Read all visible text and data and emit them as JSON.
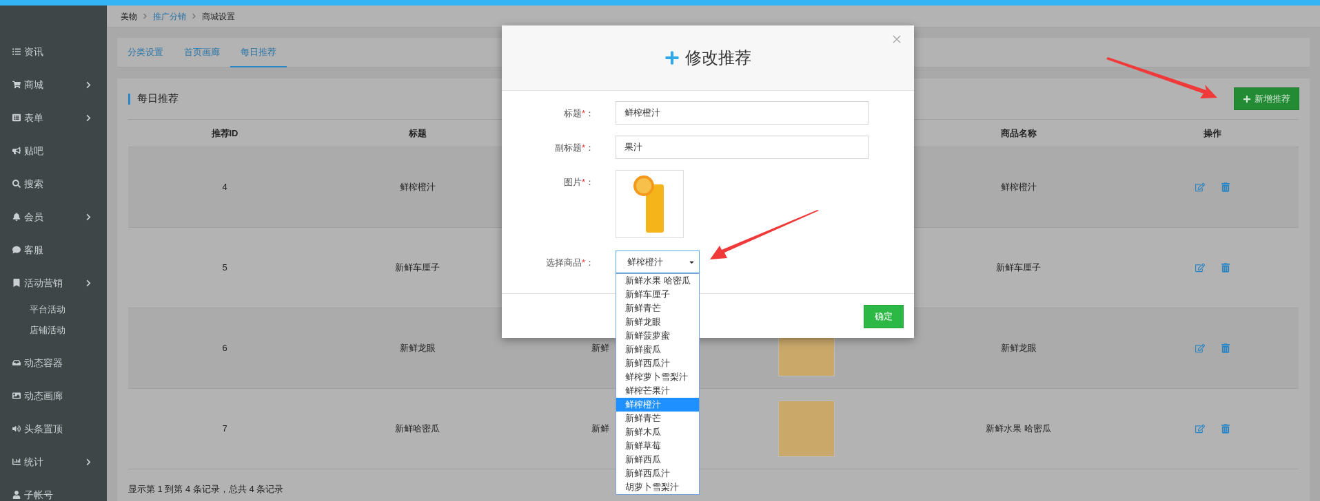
{
  "sidebar": {
    "items": [
      {
        "label": "资讯",
        "submenu": false
      },
      {
        "label": "商城",
        "submenu": true
      },
      {
        "label": "表单",
        "submenu": true
      },
      {
        "label": "贴吧",
        "submenu": false
      },
      {
        "label": "搜索",
        "submenu": false
      },
      {
        "label": "会员",
        "submenu": true
      },
      {
        "label": "客服",
        "submenu": false
      },
      {
        "label": "活动营销",
        "submenu": true,
        "children": [
          {
            "label": "平台活动"
          },
          {
            "label": "店铺活动"
          }
        ]
      },
      {
        "label": "动态容器",
        "submenu": false
      },
      {
        "label": "动态画廊",
        "submenu": false
      },
      {
        "label": "头条置顶",
        "submenu": false
      },
      {
        "label": "统计",
        "submenu": true
      },
      {
        "label": "子帐号",
        "submenu": false
      }
    ]
  },
  "breadcrumb": [
    {
      "label": "美物",
      "link": false
    },
    {
      "label": "推广分销",
      "link": true
    },
    {
      "label": "商城设置",
      "link": false
    }
  ],
  "tabs": [
    {
      "label": "分类设置",
      "selected": false
    },
    {
      "label": "首页画廊",
      "selected": false
    },
    {
      "label": "每日推荐",
      "selected": true
    }
  ],
  "panel": {
    "title": "每日推荐",
    "add_button": "新增推荐"
  },
  "table": {
    "columns": [
      "推荐ID",
      "标题",
      "",
      "",
      "商品名称",
      "操作"
    ],
    "rows": [
      {
        "id": "4",
        "title": "鲜榨橙汁",
        "column_3": "",
        "photo": false,
        "product": "鲜榨橙汁"
      },
      {
        "id": "5",
        "title": "新鲜车厘子",
        "column_3": "",
        "photo": false,
        "product": "新鲜车厘子"
      },
      {
        "id": "6",
        "title": "新鲜龙眼",
        "column_3": "新鲜",
        "photo": true,
        "product": "新鲜龙眼"
      },
      {
        "id": "7",
        "title": "新鲜哈密瓜",
        "column_3": "新鲜",
        "photo": true,
        "product": "新鲜水果 哈密瓜"
      }
    ]
  },
  "footer": "显示第 1 到第 4 条记录，总共 4 条记录",
  "modal": {
    "title": "修改推荐",
    "fields": [
      {
        "kind": "text",
        "label": "标题",
        "required_mark": "*",
        "colon": "：",
        "value": "鲜榨橙汁"
      },
      {
        "kind": "text",
        "label": "副标题",
        "required_mark": "*",
        "colon": "：",
        "value": "果汁"
      },
      {
        "kind": "image",
        "label": "图片",
        "required_mark": "*",
        "colon": "："
      },
      {
        "kind": "select",
        "label": "选择商品",
        "required_mark": "*",
        "colon": "：",
        "value": "鲜榨橙汁",
        "options": [
          {
            "label": "新鲜水果 哈密瓜",
            "selected": false
          },
          {
            "label": "新鲜车厘子",
            "selected": false
          },
          {
            "label": "新鲜青芒",
            "selected": false
          },
          {
            "label": "新鲜龙眼",
            "selected": false
          },
          {
            "label": "新鲜菠萝蜜",
            "selected": false
          },
          {
            "label": "新鲜蜜瓜",
            "selected": false
          },
          {
            "label": "新鲜西瓜汁",
            "selected": false
          },
          {
            "label": "鲜榨萝卜雪梨汁",
            "selected": false
          },
          {
            "label": "鲜榨芒果汁",
            "selected": false
          },
          {
            "label": "鲜榨橙汁",
            "selected": true
          },
          {
            "label": "新鲜青芒",
            "selected": false
          },
          {
            "label": "新鲜木瓜",
            "selected": false
          },
          {
            "label": "新鲜草莓",
            "selected": false
          },
          {
            "label": "新鲜西瓜",
            "selected": false
          },
          {
            "label": "新鲜西瓜汁",
            "selected": false
          },
          {
            "label": "胡萝卜雪梨汁",
            "selected": false
          }
        ]
      }
    ],
    "submit": "确定"
  }
}
